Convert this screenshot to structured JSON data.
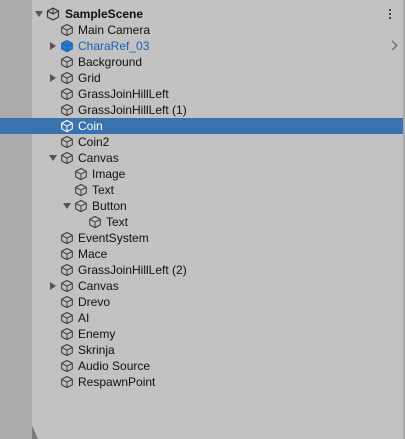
{
  "hierarchy": {
    "scene_name": "SampleScene",
    "items": [
      {
        "label": "Main Camera",
        "depth": 0,
        "foldout": "none",
        "icon": "gameobject-icon"
      },
      {
        "label": "CharaRef_03",
        "depth": 0,
        "foldout": "collapsed",
        "icon": "prefab-icon",
        "prefab": true,
        "chevron": true
      },
      {
        "label": "Background",
        "depth": 0,
        "foldout": "none",
        "icon": "gameobject-icon"
      },
      {
        "label": "Grid",
        "depth": 0,
        "foldout": "collapsed",
        "icon": "gameobject-icon"
      },
      {
        "label": "GrassJoinHillLeft",
        "depth": 0,
        "foldout": "none",
        "icon": "gameobject-icon"
      },
      {
        "label": "GrassJoinHillLeft (1)",
        "depth": 0,
        "foldout": "none",
        "icon": "gameobject-icon"
      },
      {
        "label": "Coin",
        "depth": 0,
        "foldout": "none",
        "icon": "gameobject-icon",
        "selected": true
      },
      {
        "label": "Coin2",
        "depth": 0,
        "foldout": "none",
        "icon": "gameobject-icon"
      },
      {
        "label": "Canvas",
        "depth": 0,
        "foldout": "expanded",
        "icon": "gameobject-icon"
      },
      {
        "label": "Image",
        "depth": 1,
        "foldout": "none",
        "icon": "gameobject-icon"
      },
      {
        "label": "Text",
        "depth": 1,
        "foldout": "none",
        "icon": "gameobject-icon"
      },
      {
        "label": "Button",
        "depth": 1,
        "foldout": "expanded",
        "icon": "gameobject-icon"
      },
      {
        "label": "Text",
        "depth": 2,
        "foldout": "none",
        "icon": "gameobject-icon"
      },
      {
        "label": "EventSystem",
        "depth": 0,
        "foldout": "none",
        "icon": "gameobject-icon"
      },
      {
        "label": "Mace",
        "depth": 0,
        "foldout": "none",
        "icon": "gameobject-icon"
      },
      {
        "label": "GrassJoinHillLeft (2)",
        "depth": 0,
        "foldout": "none",
        "icon": "gameobject-icon"
      },
      {
        "label": "Canvas",
        "depth": 0,
        "foldout": "collapsed",
        "icon": "gameobject-icon"
      },
      {
        "label": "Drevo",
        "depth": 0,
        "foldout": "none",
        "icon": "gameobject-icon"
      },
      {
        "label": "AI",
        "depth": 0,
        "foldout": "none",
        "icon": "gameobject-icon"
      },
      {
        "label": "Enemy",
        "depth": 0,
        "foldout": "none",
        "icon": "gameobject-icon"
      },
      {
        "label": "Skrinja",
        "depth": 0,
        "foldout": "none",
        "icon": "gameobject-icon"
      },
      {
        "label": "Audio Source",
        "depth": 0,
        "foldout": "none",
        "icon": "gameobject-icon"
      },
      {
        "label": "RespawnPoint",
        "depth": 0,
        "foldout": "none",
        "icon": "gameobject-icon"
      }
    ]
  },
  "colors": {
    "selection": "#3a72b0",
    "prefab_text": "#1d5fb3",
    "prefab_icon": "#2a78d6",
    "panel_bg": "#c2c2c2",
    "gutter_bg": "#ababab"
  }
}
